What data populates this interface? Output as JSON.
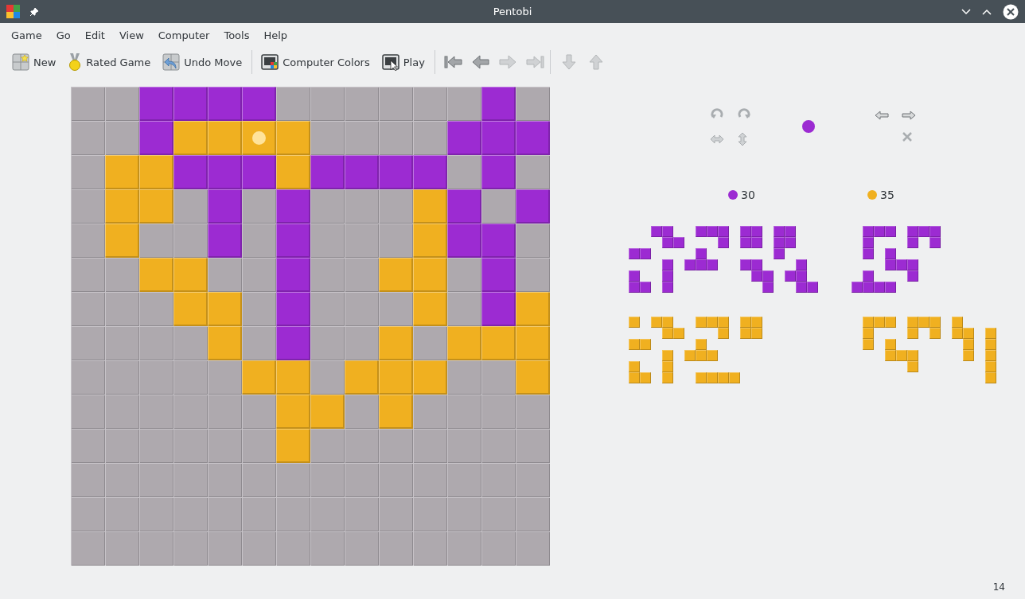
{
  "window": {
    "title": "Pentobi"
  },
  "menu": [
    "Game",
    "Go",
    "Edit",
    "View",
    "Computer",
    "Tools",
    "Help"
  ],
  "toolbar": [
    {
      "kind": "button",
      "label": "New"
    },
    {
      "kind": "button",
      "label": "Rated Game"
    },
    {
      "kind": "button",
      "label": "Undo Move"
    },
    {
      "kind": "separator"
    },
    {
      "kind": "button",
      "label": "Computer Colors"
    },
    {
      "kind": "button",
      "label": "Play"
    },
    {
      "kind": "separator"
    },
    {
      "kind": "nav",
      "disabled": false
    },
    {
      "kind": "nav",
      "disabled": false
    },
    {
      "kind": "nav",
      "disabled": true
    },
    {
      "kind": "nav",
      "disabled": true
    },
    {
      "kind": "separator"
    },
    {
      "kind": "nav",
      "disabled": true
    },
    {
      "kind": "nav",
      "disabled": true
    }
  ],
  "current_player": {
    "color": "#9c2bd2"
  },
  "players": [
    {
      "color": "#9c2bd2",
      "score": "30"
    },
    {
      "color": "#f0b020",
      "score": "35"
    }
  ],
  "board": {
    "rows": [
      [
        {
          "kind": "empty"
        },
        {
          "kind": "empty"
        },
        {
          "kind": "piece",
          "color": "#9c2bd2"
        },
        {
          "kind": "piece",
          "color": "#9c2bd2"
        },
        {
          "kind": "piece",
          "color": "#9c2bd2"
        },
        {
          "kind": "piece",
          "color": "#9c2bd2"
        },
        {
          "kind": "empty"
        },
        {
          "kind": "empty"
        },
        {
          "kind": "empty"
        },
        {
          "kind": "empty"
        },
        {
          "kind": "empty"
        },
        {
          "kind": "empty"
        },
        {
          "kind": "piece",
          "color": "#9c2bd2"
        },
        {
          "kind": "empty"
        }
      ],
      [
        {
          "kind": "empty"
        },
        {
          "kind": "empty"
        },
        {
          "kind": "piece",
          "color": "#9c2bd2"
        },
        {
          "kind": "piece",
          "color": "#f0b020"
        },
        {
          "kind": "piece",
          "color": "#f0b020"
        },
        {
          "kind": "last-move",
          "color": "#f0b020"
        },
        {
          "kind": "piece",
          "color": "#f0b020"
        },
        {
          "kind": "empty"
        },
        {
          "kind": "empty"
        },
        {
          "kind": "empty"
        },
        {
          "kind": "empty"
        },
        {
          "kind": "piece",
          "color": "#9c2bd2"
        },
        {
          "kind": "piece",
          "color": "#9c2bd2"
        },
        {
          "kind": "piece",
          "color": "#9c2bd2"
        }
      ],
      [
        {
          "kind": "empty"
        },
        {
          "kind": "piece",
          "color": "#f0b020"
        },
        {
          "kind": "piece",
          "color": "#f0b020"
        },
        {
          "kind": "piece",
          "color": "#9c2bd2"
        },
        {
          "kind": "piece",
          "color": "#9c2bd2"
        },
        {
          "kind": "piece",
          "color": "#9c2bd2"
        },
        {
          "kind": "piece",
          "color": "#f0b020"
        },
        {
          "kind": "piece",
          "color": "#9c2bd2"
        },
        {
          "kind": "piece",
          "color": "#9c2bd2"
        },
        {
          "kind": "piece",
          "color": "#9c2bd2"
        },
        {
          "kind": "piece",
          "color": "#9c2bd2"
        },
        {
          "kind": "empty"
        },
        {
          "kind": "piece",
          "color": "#9c2bd2"
        },
        {
          "kind": "empty"
        }
      ],
      [
        {
          "kind": "empty"
        },
        {
          "kind": "piece",
          "color": "#f0b020"
        },
        {
          "kind": "piece",
          "color": "#f0b020"
        },
        {
          "kind": "empty"
        },
        {
          "kind": "piece",
          "color": "#9c2bd2"
        },
        {
          "kind": "empty"
        },
        {
          "kind": "piece",
          "color": "#9c2bd2"
        },
        {
          "kind": "empty"
        },
        {
          "kind": "empty"
        },
        {
          "kind": "empty"
        },
        {
          "kind": "piece",
          "color": "#f0b020"
        },
        {
          "kind": "piece",
          "color": "#9c2bd2"
        },
        {
          "kind": "empty"
        },
        {
          "kind": "piece",
          "color": "#9c2bd2"
        }
      ],
      [
        {
          "kind": "empty"
        },
        {
          "kind": "piece",
          "color": "#f0b020"
        },
        {
          "kind": "empty"
        },
        {
          "kind": "empty"
        },
        {
          "kind": "piece",
          "color": "#9c2bd2"
        },
        {
          "kind": "empty"
        },
        {
          "kind": "piece",
          "color": "#9c2bd2"
        },
        {
          "kind": "empty"
        },
        {
          "kind": "empty"
        },
        {
          "kind": "empty"
        },
        {
          "kind": "piece",
          "color": "#f0b020"
        },
        {
          "kind": "piece",
          "color": "#9c2bd2"
        },
        {
          "kind": "piece",
          "color": "#9c2bd2"
        },
        {
          "kind": "empty"
        }
      ],
      [
        {
          "kind": "empty"
        },
        {
          "kind": "empty"
        },
        {
          "kind": "piece",
          "color": "#f0b020"
        },
        {
          "kind": "piece",
          "color": "#f0b020"
        },
        {
          "kind": "empty"
        },
        {
          "kind": "empty"
        },
        {
          "kind": "piece",
          "color": "#9c2bd2"
        },
        {
          "kind": "empty"
        },
        {
          "kind": "empty"
        },
        {
          "kind": "piece",
          "color": "#f0b020"
        },
        {
          "kind": "piece",
          "color": "#f0b020"
        },
        {
          "kind": "empty"
        },
        {
          "kind": "piece",
          "color": "#9c2bd2"
        },
        {
          "kind": "empty"
        }
      ],
      [
        {
          "kind": "empty"
        },
        {
          "kind": "empty"
        },
        {
          "kind": "empty"
        },
        {
          "kind": "piece",
          "color": "#f0b020"
        },
        {
          "kind": "piece",
          "color": "#f0b020"
        },
        {
          "kind": "empty"
        },
        {
          "kind": "piece",
          "color": "#9c2bd2"
        },
        {
          "kind": "empty"
        },
        {
          "kind": "empty"
        },
        {
          "kind": "empty"
        },
        {
          "kind": "piece",
          "color": "#f0b020"
        },
        {
          "kind": "empty"
        },
        {
          "kind": "piece",
          "color": "#9c2bd2"
        },
        {
          "kind": "piece",
          "color": "#f0b020"
        }
      ],
      [
        {
          "kind": "empty"
        },
        {
          "kind": "empty"
        },
        {
          "kind": "empty"
        },
        {
          "kind": "empty"
        },
        {
          "kind": "piece",
          "color": "#f0b020"
        },
        {
          "kind": "empty"
        },
        {
          "kind": "piece",
          "color": "#9c2bd2"
        },
        {
          "kind": "empty"
        },
        {
          "kind": "empty"
        },
        {
          "kind": "piece",
          "color": "#f0b020"
        },
        {
          "kind": "empty"
        },
        {
          "kind": "piece",
          "color": "#f0b020"
        },
        {
          "kind": "piece",
          "color": "#f0b020"
        },
        {
          "kind": "piece",
          "color": "#f0b020"
        }
      ],
      [
        {
          "kind": "empty"
        },
        {
          "kind": "empty"
        },
        {
          "kind": "empty"
        },
        {
          "kind": "empty"
        },
        {
          "kind": "empty"
        },
        {
          "kind": "piece",
          "color": "#f0b020"
        },
        {
          "kind": "piece",
          "color": "#f0b020"
        },
        {
          "kind": "empty"
        },
        {
          "kind": "piece",
          "color": "#f0b020"
        },
        {
          "kind": "piece",
          "color": "#f0b020"
        },
        {
          "kind": "piece",
          "color": "#f0b020"
        },
        {
          "kind": "empty"
        },
        {
          "kind": "empty"
        },
        {
          "kind": "piece",
          "color": "#f0b020"
        }
      ],
      [
        {
          "kind": "empty"
        },
        {
          "kind": "empty"
        },
        {
          "kind": "empty"
        },
        {
          "kind": "empty"
        },
        {
          "kind": "empty"
        },
        {
          "kind": "empty"
        },
        {
          "kind": "piece",
          "color": "#f0b020"
        },
        {
          "kind": "piece",
          "color": "#f0b020"
        },
        {
          "kind": "empty"
        },
        {
          "kind": "piece",
          "color": "#f0b020"
        },
        {
          "kind": "empty"
        },
        {
          "kind": "empty"
        },
        {
          "kind": "empty"
        },
        {
          "kind": "empty"
        }
      ],
      [
        {
          "kind": "empty"
        },
        {
          "kind": "empty"
        },
        {
          "kind": "empty"
        },
        {
          "kind": "empty"
        },
        {
          "kind": "empty"
        },
        {
          "kind": "empty"
        },
        {
          "kind": "piece",
          "color": "#f0b020"
        },
        {
          "kind": "empty"
        },
        {
          "kind": "empty"
        },
        {
          "kind": "empty"
        },
        {
          "kind": "empty"
        },
        {
          "kind": "empty"
        },
        {
          "kind": "empty"
        },
        {
          "kind": "empty"
        }
      ],
      [
        {
          "kind": "empty"
        },
        {
          "kind": "empty"
        },
        {
          "kind": "empty"
        },
        {
          "kind": "empty"
        },
        {
          "kind": "empty"
        },
        {
          "kind": "empty"
        },
        {
          "kind": "empty"
        },
        {
          "kind": "empty"
        },
        {
          "kind": "empty"
        },
        {
          "kind": "empty"
        },
        {
          "kind": "empty"
        },
        {
          "kind": "empty"
        },
        {
          "kind": "empty"
        },
        {
          "kind": "empty"
        }
      ],
      [
        {
          "kind": "empty"
        },
        {
          "kind": "empty"
        },
        {
          "kind": "empty"
        },
        {
          "kind": "empty"
        },
        {
          "kind": "empty"
        },
        {
          "kind": "empty"
        },
        {
          "kind": "empty"
        },
        {
          "kind": "empty"
        },
        {
          "kind": "empty"
        },
        {
          "kind": "empty"
        },
        {
          "kind": "empty"
        },
        {
          "kind": "empty"
        },
        {
          "kind": "empty"
        },
        {
          "kind": "empty"
        }
      ],
      [
        {
          "kind": "empty"
        },
        {
          "kind": "empty"
        },
        {
          "kind": "empty"
        },
        {
          "kind": "empty"
        },
        {
          "kind": "empty"
        },
        {
          "kind": "empty"
        },
        {
          "kind": "empty"
        },
        {
          "kind": "empty"
        },
        {
          "kind": "empty"
        },
        {
          "kind": "empty"
        },
        {
          "kind": "empty"
        },
        {
          "kind": "empty"
        },
        {
          "kind": "empty"
        },
        {
          "kind": "empty"
        }
      ]
    ]
  },
  "status_bar": {
    "move_number": "14"
  }
}
